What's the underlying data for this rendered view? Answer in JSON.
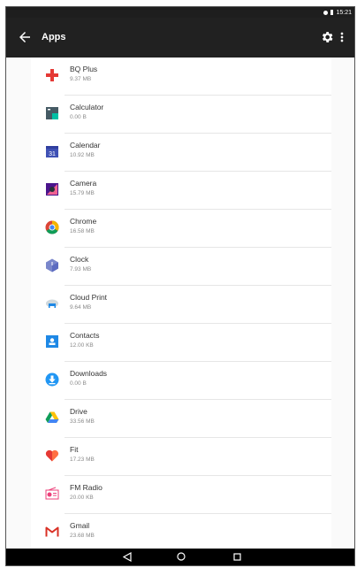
{
  "status_bar": {
    "time": "15:21"
  },
  "app_bar": {
    "title": "Apps"
  },
  "apps": [
    {
      "name": "BQ Plus",
      "size": "9.37 MB",
      "icon": "bq-plus-icon",
      "color": "#e53935"
    },
    {
      "name": "Calculator",
      "size": "0.00 B",
      "icon": "calculator-icon",
      "color": "#455a64"
    },
    {
      "name": "Calendar",
      "size": "10.92 MB",
      "icon": "calendar-icon",
      "color": "#3f51b5"
    },
    {
      "name": "Camera",
      "size": "15.79 MB",
      "icon": "camera-icon",
      "color": "#6a1b9a"
    },
    {
      "name": "Chrome",
      "size": "16.58 MB",
      "icon": "chrome-icon",
      "color": "#f4b400"
    },
    {
      "name": "Clock",
      "size": "7.93 MB",
      "icon": "clock-icon",
      "color": "#7986cb"
    },
    {
      "name": "Cloud Print",
      "size": "9.64 MB",
      "icon": "cloud-print-icon",
      "color": "#90a4ae"
    },
    {
      "name": "Contacts",
      "size": "12.00 KB",
      "icon": "contacts-icon",
      "color": "#1e88e5"
    },
    {
      "name": "Downloads",
      "size": "0.00 B",
      "icon": "downloads-icon",
      "color": "#2196f3"
    },
    {
      "name": "Drive",
      "size": "33.56 MB",
      "icon": "drive-icon",
      "color": "#0f9d58"
    },
    {
      "name": "Fit",
      "size": "17.23 MB",
      "icon": "fit-icon",
      "color": "#ff7043"
    },
    {
      "name": "FM Radio",
      "size": "20.00 KB",
      "icon": "fm-radio-icon",
      "color": "#ec407a"
    },
    {
      "name": "Gmail",
      "size": "23.68 MB",
      "icon": "gmail-icon",
      "color": "#d93025"
    }
  ]
}
